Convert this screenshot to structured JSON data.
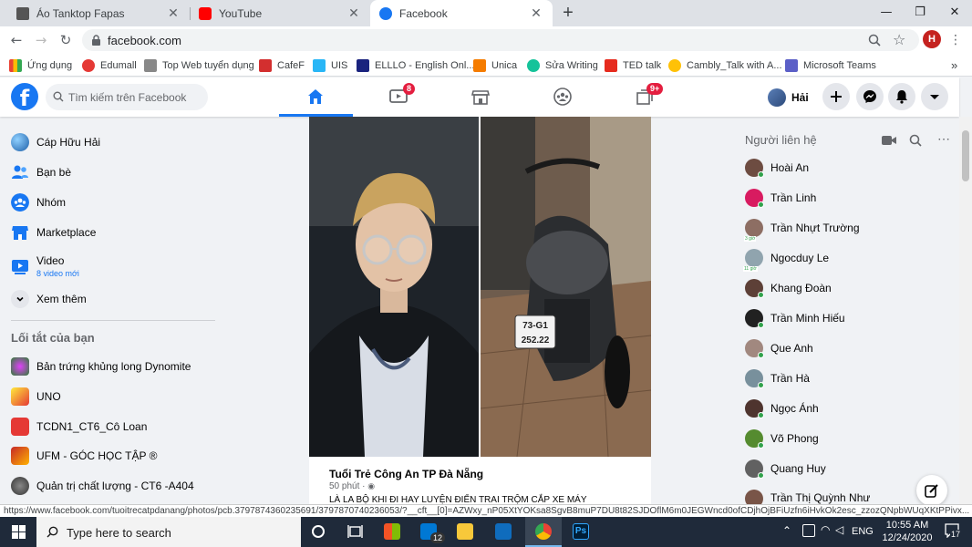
{
  "browser": {
    "tabs": [
      {
        "title": "Áo Tanktop Fapas",
        "active": false
      },
      {
        "title": "YouTube",
        "active": false
      },
      {
        "title": "Facebook",
        "active": true
      }
    ],
    "url": "facebook.com",
    "profile_initial": "H",
    "bookmarks": [
      {
        "label": "Ứng dụng",
        "icon": "apps-grid-icon"
      },
      {
        "label": "Edumall",
        "icon": "edumall-icon"
      },
      {
        "label": "Top Web tuyển dụng",
        "icon": "topweb-icon"
      },
      {
        "label": "CafeF",
        "icon": "cafef-icon"
      },
      {
        "label": "UIS",
        "icon": "uis-icon"
      },
      {
        "label": "ELLLO - English Onl...",
        "icon": "elllo-icon"
      },
      {
        "label": "Unica",
        "icon": "unica-icon"
      },
      {
        "label": "Sửa Writing",
        "icon": "grammarly-icon"
      },
      {
        "label": "TED talk",
        "icon": "ted-icon"
      },
      {
        "label": "Cambly_Talk with A...",
        "icon": "cambly-icon"
      },
      {
        "label": "Microsoft Teams",
        "icon": "teams-icon"
      }
    ],
    "bookmarks_overflow": "»",
    "status_url": "https://www.facebook.com/tuoitrecatpdanang/photos/pcb.3797874360235691/3797870740236053/?__cft__[0]=AZWxy_nP05XtYOKsa8SgvB8muP7DU8t82SJDOflM6m0JEGWncd0ofCDjhOjBFiUzfn6iHvkOk2esc_zzozQNpbWUqXKtPPivx..."
  },
  "facebook": {
    "search_placeholder": "Tìm kiếm trên Facebook",
    "nav_badges": {
      "watch": "8",
      "gaming": "9+"
    },
    "profile_name": "Hải",
    "left_sidebar": [
      {
        "label": "Cáp Hữu Hải",
        "icon": "profile-avatar"
      },
      {
        "label": "Bạn bè",
        "icon": "friends-icon"
      },
      {
        "label": "Nhóm",
        "icon": "groups-icon"
      },
      {
        "label": "Marketplace",
        "icon": "marketplace-icon"
      },
      {
        "label": "Video",
        "icon": "video-icon",
        "sub": "8 video mới"
      },
      {
        "label": "Xem thêm",
        "icon": "chevron-down-icon"
      }
    ],
    "shortcuts_title": "Lối tắt của bạn",
    "shortcuts": [
      {
        "label": "Bản trứng khủng long Dynomite"
      },
      {
        "label": "UNO"
      },
      {
        "label": "TCDN1_CT6_Cô Loan"
      },
      {
        "label": "UFM - GÓC HỌC TẬP ®"
      },
      {
        "label": "Quản trị chất lượng - CT6 -A404"
      }
    ],
    "post": {
      "author": "Tuổi Trẻ Công An TP Đà Nẵng",
      "time": "50 phút · ",
      "plate": "73-G1 252.22",
      "text_preview": "LÀ LA BỘ KHI ĐI HAY LUYỆN ĐIỂN TRAI TRỘM CẮP XE MÁY"
    },
    "contacts_title": "Người liên hệ",
    "contacts": [
      {
        "name": "Hoài An",
        "online": true
      },
      {
        "name": "Trần Linh",
        "online": true
      },
      {
        "name": "Trần Nhựt Trường",
        "online": false,
        "badge": "3 giờ"
      },
      {
        "name": "Ngocduy Le",
        "online": false,
        "badge": "11 giờ"
      },
      {
        "name": "Khang Đoàn",
        "online": true
      },
      {
        "name": "Trần Minh Hiếu",
        "online": true
      },
      {
        "name": "Que Anh",
        "online": true
      },
      {
        "name": "Trần Hà",
        "online": true
      },
      {
        "name": "Ngọc Ánh",
        "online": true
      },
      {
        "name": "Võ Phong",
        "online": true
      },
      {
        "name": "Quang Huy",
        "online": true
      },
      {
        "name": "Trần Thị Quỳnh Như",
        "online": true
      }
    ]
  },
  "taskbar": {
    "search_placeholder": "Type here to search",
    "mail_badge": "12",
    "language": "ENG",
    "time": "10:55 AM",
    "date": "12/24/2020",
    "notification_count": "17"
  },
  "colors": {
    "fb_blue": "#1877f2",
    "badge_red": "#e41e3f",
    "online_green": "#31a24c",
    "taskbar": "#1f2a3a"
  }
}
